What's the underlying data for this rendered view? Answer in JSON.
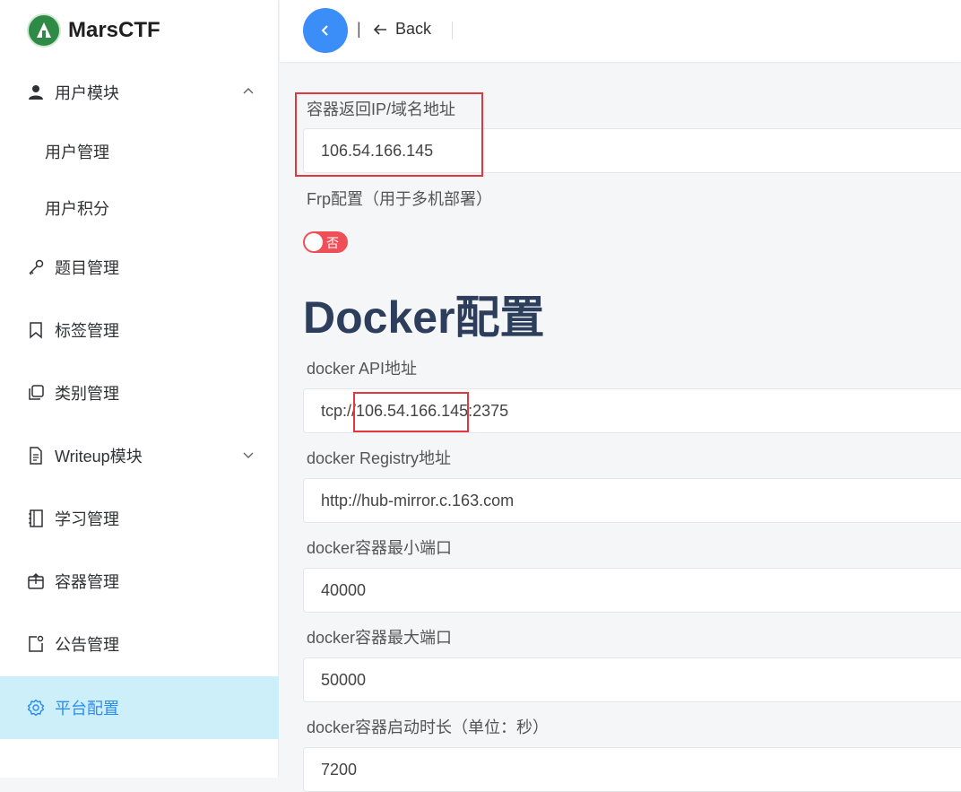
{
  "brand": {
    "name": "MarsCTF"
  },
  "sidebar": {
    "items": [
      {
        "label": "用户模块",
        "icon": "user-icon",
        "expanded": true
      },
      {
        "label": "用户管理",
        "submenu": true
      },
      {
        "label": "用户积分",
        "submenu": true
      },
      {
        "label": "题目管理",
        "icon": "key-icon"
      },
      {
        "label": "标签管理",
        "icon": "bookmark-icon"
      },
      {
        "label": "类别管理",
        "icon": "copy-icon"
      },
      {
        "label": "Writeup模块",
        "icon": "document-icon",
        "expanded": false
      },
      {
        "label": "学习管理",
        "icon": "notebook-icon"
      },
      {
        "label": "容器管理",
        "icon": "box-icon"
      },
      {
        "label": "公告管理",
        "icon": "notice-icon"
      },
      {
        "label": "平台配置",
        "icon": "gear-icon",
        "active": true
      }
    ]
  },
  "header": {
    "separator": "|",
    "back_label": "Back"
  },
  "form": {
    "container_ip": {
      "label": "容器返回IP/域名地址",
      "value": "106.54.166.145"
    },
    "frp": {
      "label": "Frp配置（用于多机部署）",
      "switch_text": "否",
      "enabled": false
    },
    "docker_section_title": "Docker配置",
    "docker_api": {
      "label": "docker API地址",
      "value": "tcp://106.54.166.145:2375"
    },
    "docker_registry": {
      "label": "docker Registry地址",
      "value": "http://hub-mirror.c.163.com"
    },
    "min_port": {
      "label": "docker容器最小端口",
      "value": "40000"
    },
    "max_port": {
      "label": "docker容器最大端口",
      "value": "50000"
    },
    "duration": {
      "label": "docker容器启动时长（单位：秒）",
      "value": "7200"
    }
  },
  "colors": {
    "accent": "#3b8ef7",
    "active_bg": "#cdeffa",
    "switch_off": "#ef4f56",
    "highlight": "#e0383e"
  }
}
